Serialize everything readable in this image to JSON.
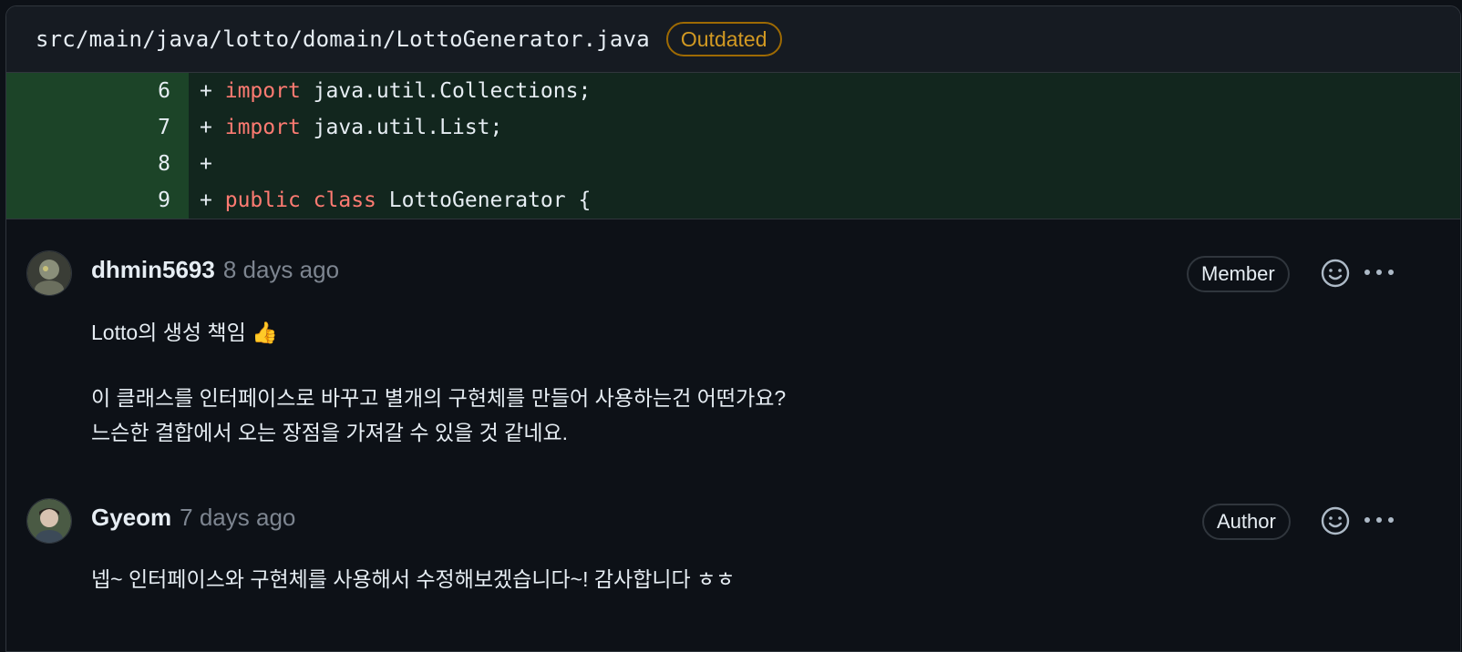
{
  "file": {
    "path": "src/main/java/lotto/domain/LottoGenerator.java",
    "badge": "Outdated"
  },
  "diff": [
    {
      "num": "6",
      "sign": "+",
      "tokens": [
        {
          "t": "import",
          "kw": true
        },
        {
          "t": " java.util.Collections;",
          "kw": false
        }
      ]
    },
    {
      "num": "7",
      "sign": "+",
      "tokens": [
        {
          "t": "import",
          "kw": true
        },
        {
          "t": " java.util.List;",
          "kw": false
        }
      ]
    },
    {
      "num": "8",
      "sign": "+",
      "tokens": []
    },
    {
      "num": "9",
      "sign": "+",
      "tokens": [
        {
          "t": "public",
          "kw": true
        },
        {
          "t": " ",
          "kw": false
        },
        {
          "t": "class",
          "kw": true
        },
        {
          "t": " LottoGenerator {",
          "kw": false
        }
      ]
    }
  ],
  "comments": [
    {
      "author": "dhmin5693",
      "time": "8 days ago",
      "role": "Member",
      "avatar_color": "#8a8f7a",
      "lines": [
        "Lotto의 생성 책임 👍",
        "",
        "이 클래스를 인터페이스로 바꾸고 별개의 구현체를 만들어 사용하는건 어떤가요?",
        "느슨한 결합에서 오는 장점을 가져갈 수 있을 것 같네요."
      ]
    },
    {
      "author": "Gyeom",
      "time": "7 days ago",
      "role": "Author",
      "avatar_color": "#6f8a6a",
      "lines": [
        "넵~ 인터페이스와 구현체를 사용해서 수정해보겠습니다~! 감사합니다 ㅎㅎ"
      ]
    }
  ],
  "icons": {
    "reaction": "smiley-icon",
    "more": "kebab-horizontal-icon"
  },
  "colors": {
    "background": "#0d1117",
    "added_line_number": "#1c4428",
    "added_line": "#12261e",
    "keyword": "#ff7b72",
    "outdated": "#d29922"
  }
}
